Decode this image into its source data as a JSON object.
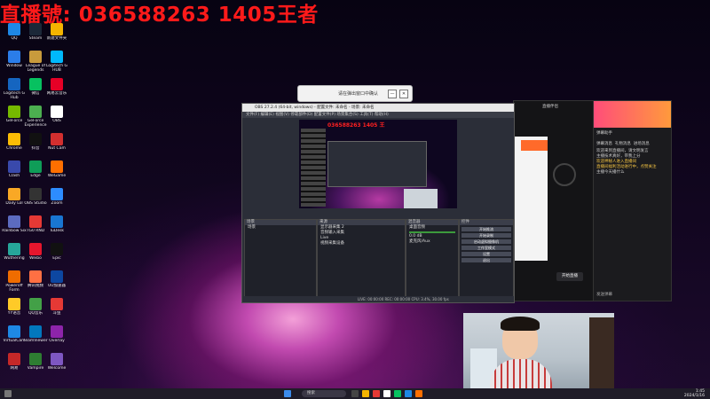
{
  "overlay": {
    "title": "直播號: 036588263  1405王者"
  },
  "desktop_icons": [
    {
      "label": "QQ",
      "color": "#1e88e5"
    },
    {
      "label": "Steam",
      "color": "#1b2838"
    },
    {
      "label": "新建文件夹",
      "color": "#f4b400"
    },
    {
      "label": "Window",
      "color": "#2b7de9"
    },
    {
      "label": "League of Legends",
      "color": "#c89b3c"
    },
    {
      "label": "Logitech G HUB",
      "color": "#00b8fc"
    },
    {
      "label": "Logitech G Hub",
      "color": "#1565c0"
    },
    {
      "label": "微信",
      "color": "#07c160"
    },
    {
      "label": "网易云音乐",
      "color": "#e60026"
    },
    {
      "label": "GeForce",
      "color": "#76b900"
    },
    {
      "label": "GeForce Experience",
      "color": "#4caf50"
    },
    {
      "label": "OBS",
      "color": "#ffffff"
    },
    {
      "label": "Chrome",
      "color": "#fbbc05"
    },
    {
      "label": "抖音",
      "color": "#111111"
    },
    {
      "label": "Nut Cam",
      "color": "#d32f2f"
    },
    {
      "label": "Clash",
      "color": "#3949ab"
    },
    {
      "label": "Edge",
      "color": "#0f9d58"
    },
    {
      "label": "WeGame",
      "color": "#ff6f00"
    },
    {
      "label": "Daily Lol",
      "color": "#f9a825"
    },
    {
      "label": "OBS Studio",
      "color": "#333333"
    },
    {
      "label": "Zoom",
      "color": "#2d8cff"
    },
    {
      "label": "Rainbow Six",
      "color": "#5c6bc0"
    },
    {
      "label": "TG0 RND",
      "color": "#e53935"
    },
    {
      "label": "TuDesk",
      "color": "#1976d2"
    },
    {
      "label": "Wuthering",
      "color": "#26a69a"
    },
    {
      "label": "Weibo",
      "color": "#e6162d"
    },
    {
      "label": "Epic",
      "color": "#111111"
    },
    {
      "label": "Poweroff Form",
      "color": "#ef6c00"
    },
    {
      "label": "腾讯视频",
      "color": "#ff7043"
    },
    {
      "label": "UU加速器",
      "color": "#0d47a1"
    },
    {
      "label": "YY语音",
      "color": "#ffca28"
    },
    {
      "label": "QQ音乐",
      "color": "#43a047"
    },
    {
      "label": "斗鱼",
      "color": "#e53935"
    },
    {
      "label": "VirtualCam",
      "color": "#1e88e5"
    },
    {
      "label": "TeamViewer",
      "color": "#0277bd"
    },
    {
      "label": "Overlay",
      "color": "#8e24aa"
    },
    {
      "label": "网易",
      "color": "#c62828"
    },
    {
      "label": "Vampire",
      "color": "#2e7d32"
    },
    {
      "label": "Welcome",
      "color": "#7e57c2"
    }
  ],
  "popup": {
    "text": "请在弹出窗口中确认",
    "min": "—",
    "max": "□",
    "close": "✕"
  },
  "obs": {
    "title": "OBS 27.2.4 (64-bit, windows) - 配置文件: 未命名 - 场景: 未命名",
    "menu": "文件(F)  编辑(E)  视图(V)  停靠部件(D)  配置文件(P)  场景集合(S)  工具(T)  帮助(H)",
    "overlay_text": "036588263  1405 王",
    "scenes_title": "场景",
    "scene_item": "场景",
    "sources_title": "来源",
    "sources": [
      "显示器采集 2",
      "音频输入采集",
      "Live",
      "视频采集设备"
    ],
    "mixer_title": "混音器",
    "mixer_items": [
      "桌面音频",
      "麦克风/Aux"
    ],
    "mixer_db": "0.0 dB",
    "controls_title": "控件",
    "controls": [
      "开始推流",
      "开始录制",
      "启动虚拟摄像机",
      "工作室模式",
      "设置",
      "退出"
    ],
    "status": "LIVE: 00:00:00   REC: 00:00:00   CPU: 3.4%, 30.00 fps"
  },
  "live_panel": {
    "start_label": "开始直播",
    "title": "直播伴侣"
  },
  "chat": {
    "header": "弹幕助手",
    "tabs": [
      "弹幕消息",
      "礼物消息",
      "进场消息"
    ],
    "messages": [
      {
        "text": "欢迎来到直播间，请文明发言",
        "highlight": false
      },
      {
        "text": "主播技术真好，带我上分",
        "highlight": false
      },
      {
        "text": "欢迎神秘人进入直播间",
        "highlight": true
      },
      {
        "text": "直播间福利活动进行中，点赞关注",
        "highlight": true
      },
      {
        "text": "主播今天播什么",
        "highlight": false
      }
    ],
    "footer": "发送弹幕"
  },
  "taskbar": {
    "search": "搜索",
    "time": "1:45",
    "date": "2024/1/16"
  }
}
